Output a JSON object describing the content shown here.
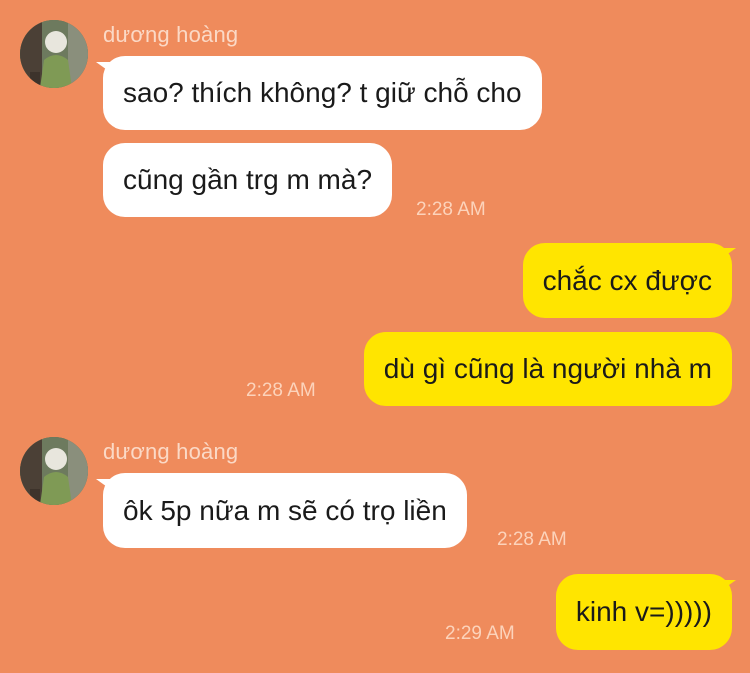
{
  "conversation": {
    "colors": {
      "background": "#ef8b5c",
      "incoming_bubble": "#ffffff",
      "outgoing_bubble": "#ffe500",
      "meta_text": "#fcd3bb"
    },
    "groups": [
      {
        "sender": "dương hoàng",
        "avatar_icon": "profile-photo-avatar-icon",
        "messages": [
          {
            "text": "sao? thích không? t giữ chỗ cho"
          },
          {
            "text": "cũng gần trg m mà?",
            "time": "2:28 AM"
          }
        ]
      },
      {
        "sender": "me",
        "messages": [
          {
            "text": "chắc cx được"
          },
          {
            "text": "dù gì cũng là người nhà m",
            "time": "2:28 AM"
          }
        ]
      },
      {
        "sender": "dương hoàng",
        "avatar_icon": "profile-photo-avatar-icon",
        "messages": [
          {
            "text": "ôk 5p nữa m sẽ có trọ liền",
            "time": "2:28 AM"
          }
        ]
      },
      {
        "sender": "me",
        "messages": [
          {
            "text": "kinh v=)))))",
            "time": "2:29 AM"
          }
        ]
      }
    ]
  }
}
